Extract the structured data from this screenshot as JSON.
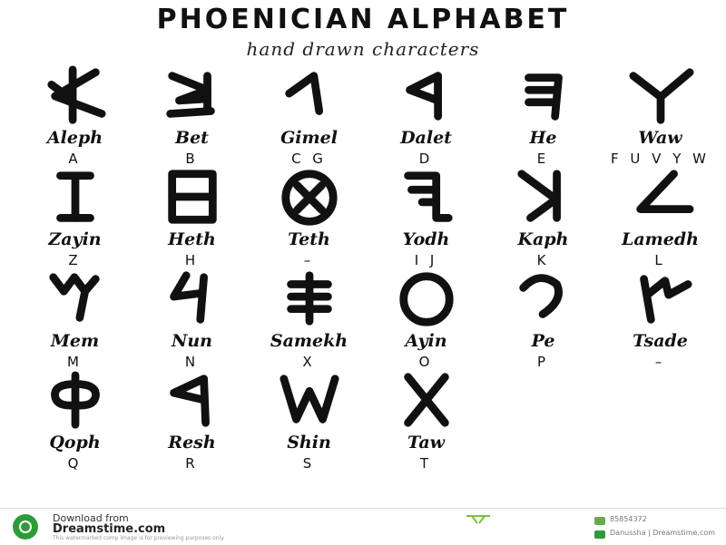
{
  "title": "PHOENICIAN ALPHABET",
  "subtitle": "hand drawn characters",
  "letters": [
    {
      "name": "Aleph",
      "latin": "A",
      "icon": "aleph-glyph"
    },
    {
      "name": "Bet",
      "latin": "B",
      "icon": "bet-glyph"
    },
    {
      "name": "Gimel",
      "latin": "C G",
      "icon": "gimel-glyph"
    },
    {
      "name": "Dalet",
      "latin": "D",
      "icon": "dalet-glyph"
    },
    {
      "name": "He",
      "latin": "E",
      "icon": "he-glyph"
    },
    {
      "name": "Waw",
      "latin": "F U V Y W",
      "icon": "waw-glyph"
    },
    {
      "name": "Zayin",
      "latin": "Z",
      "icon": "zayin-glyph"
    },
    {
      "name": "Heth",
      "latin": "H",
      "icon": "heth-glyph"
    },
    {
      "name": "Teth",
      "latin": "–",
      "icon": "teth-glyph"
    },
    {
      "name": "Yodh",
      "latin": "I J",
      "icon": "yodh-glyph"
    },
    {
      "name": "Kaph",
      "latin": "K",
      "icon": "kaph-glyph"
    },
    {
      "name": "Lamedh",
      "latin": "L",
      "icon": "lamedh-glyph"
    },
    {
      "name": "Mem",
      "latin": "M",
      "icon": "mem-glyph"
    },
    {
      "name": "Nun",
      "latin": "N",
      "icon": "nun-glyph"
    },
    {
      "name": "Samekh",
      "latin": "X",
      "icon": "samekh-glyph"
    },
    {
      "name": "Ayin",
      "latin": "O",
      "icon": "ayin-glyph"
    },
    {
      "name": "Pe",
      "latin": "P",
      "icon": "pe-glyph"
    },
    {
      "name": "Tsade",
      "latin": "–",
      "icon": "tsade-glyph"
    },
    {
      "name": "Qoph",
      "latin": "Q",
      "icon": "qoph-glyph"
    },
    {
      "name": "Resh",
      "latin": "R",
      "icon": "resh-glyph"
    },
    {
      "name": "Shin",
      "latin": "S",
      "icon": "shin-glyph"
    },
    {
      "name": "Taw",
      "latin": "T",
      "icon": "taw-glyph"
    }
  ],
  "footer": {
    "download_line1": "Download from",
    "download_line2": "Dreamstime.com",
    "watermark_note": "This watermarked comp image is for previewing purposes only.",
    "image_id": "85854372",
    "credit": "Danussha | Dreamstime.com",
    "accent_color": "#2f9a3a"
  }
}
